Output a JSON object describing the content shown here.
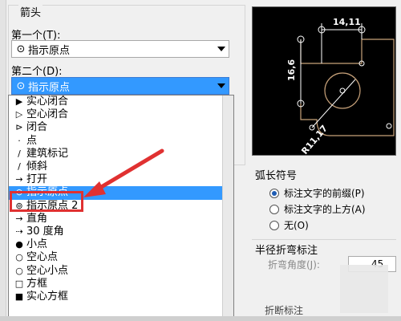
{
  "left_group": {
    "title": "箭头",
    "first_label": "第一个(T):",
    "first_value": "指示原点",
    "second_label": "第二个(D):",
    "second_value": "指示原点"
  },
  "dropdown": {
    "items": [
      {
        "icon": "▶",
        "label": "实心闭合"
      },
      {
        "icon": "▷",
        "label": "空心闭合"
      },
      {
        "icon": "⊳",
        "label": "闭合"
      },
      {
        "icon": "·",
        "label": "点"
      },
      {
        "icon": "/",
        "label": "建筑标记"
      },
      {
        "icon": "/",
        "label": "倾斜"
      },
      {
        "icon": "→",
        "label": "打开"
      },
      {
        "icon": "⊙",
        "label": "指示原点"
      },
      {
        "icon": "⊚",
        "label": "指示原点 2"
      },
      {
        "icon": "→",
        "label": "直角"
      },
      {
        "icon": "⇢",
        "label": "30 度角"
      },
      {
        "icon": "●",
        "label": "小点"
      },
      {
        "icon": "○",
        "label": "空心点"
      },
      {
        "icon": "○",
        "label": "空心小点"
      },
      {
        "icon": "□",
        "label": "方框"
      },
      {
        "icon": "■",
        "label": "实心方框"
      }
    ],
    "selected_index": 7
  },
  "preview": {
    "dim_top": "14,11",
    "dim_left": "16,6",
    "dim_radius": "R11,17"
  },
  "arc_symbol": {
    "title": "弧长符号",
    "options": [
      {
        "label": "标注文字的前缀(P)",
        "selected": true
      },
      {
        "label": "标注文字的上方(A)",
        "selected": false
      },
      {
        "label": "无(O)",
        "selected": false
      }
    ]
  },
  "radius_jog": {
    "title": "半径折弯标注",
    "angle_label": "折弯角度(J):",
    "angle_value": "45"
  },
  "linear_jog": {
    "label": "折断标注"
  },
  "colors": {
    "selection": "#3399ff",
    "highlight": "#e03131",
    "arrow": "#e03131"
  }
}
